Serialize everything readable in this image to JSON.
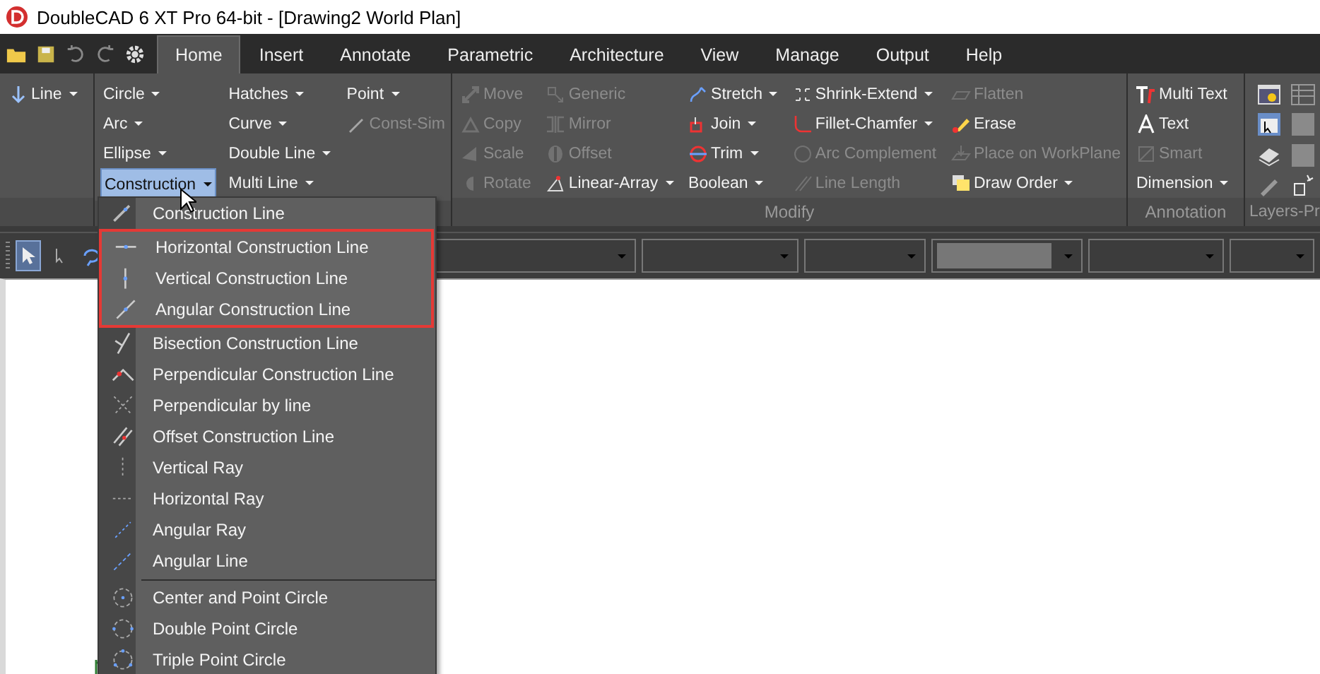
{
  "window": {
    "title": "DoubleCAD 6 XT Pro 64-bit - [Drawing2 World Plan]"
  },
  "tabs": [
    {
      "label": "Home",
      "selected": true
    },
    {
      "label": "Insert",
      "selected": false
    },
    {
      "label": "Annotate",
      "selected": false
    },
    {
      "label": "Parametric",
      "selected": false
    },
    {
      "label": "Architecture",
      "selected": false
    },
    {
      "label": "View",
      "selected": false
    },
    {
      "label": "Manage",
      "selected": false
    },
    {
      "label": "Output",
      "selected": false
    },
    {
      "label": "Help",
      "selected": false
    }
  ],
  "ribbon": {
    "groups": [
      {
        "columns": [
          [
            {
              "label": "Line",
              "dropdown": true,
              "disabled": false,
              "selected": false
            }
          ]
        ]
      },
      {
        "columns": [
          [
            {
              "label": "Circle",
              "dropdown": true,
              "disabled": false,
              "selected": false
            },
            {
              "label": "Arc",
              "dropdown": true,
              "disabled": false,
              "selected": false
            },
            {
              "label": "Ellipse",
              "dropdown": true,
              "disabled": false,
              "selected": false
            },
            {
              "label": "Construction",
              "dropdown": true,
              "disabled": false,
              "selected": true
            }
          ],
          [
            {
              "label": "Hatches",
              "dropdown": true,
              "disabled": false,
              "selected": false
            },
            {
              "label": "Curve",
              "dropdown": true,
              "disabled": false,
              "selected": false
            },
            {
              "label": "Double Line",
              "dropdown": true,
              "disabled": false,
              "selected": false
            },
            {
              "label": "Multi Line",
              "dropdown": true,
              "disabled": false,
              "selected": false
            }
          ],
          [
            {
              "label": "Point",
              "dropdown": true,
              "disabled": false,
              "selected": false
            },
            {
              "label": "Const-Sim",
              "dropdown": false,
              "disabled": true,
              "selected": false
            }
          ]
        ]
      },
      {
        "label": "Modify",
        "columns": [
          [
            {
              "label": "Move",
              "dropdown": false,
              "disabled": true,
              "selected": false
            },
            {
              "label": "Copy",
              "dropdown": false,
              "disabled": true,
              "selected": false
            },
            {
              "label": "Scale",
              "dropdown": false,
              "disabled": true,
              "selected": false
            },
            {
              "label": "Rotate",
              "dropdown": false,
              "disabled": true,
              "selected": false
            }
          ],
          [
            {
              "label": "Generic",
              "dropdown": false,
              "disabled": true,
              "selected": false
            },
            {
              "label": "Mirror",
              "dropdown": false,
              "disabled": true,
              "selected": false
            },
            {
              "label": "Offset",
              "dropdown": false,
              "disabled": true,
              "selected": false
            },
            {
              "label": "Linear-Array",
              "dropdown": true,
              "disabled": false,
              "selected": false
            }
          ],
          [
            {
              "label": "Stretch",
              "dropdown": true,
              "disabled": false,
              "selected": false
            },
            {
              "label": "Join",
              "dropdown": true,
              "disabled": false,
              "selected": false
            },
            {
              "label": "Trim",
              "dropdown": true,
              "disabled": false,
              "selected": false
            },
            {
              "label": "Boolean",
              "dropdown": true,
              "disabled": false,
              "selected": false
            }
          ],
          [
            {
              "label": "Shrink-Extend",
              "dropdown": true,
              "disabled": false,
              "selected": false
            },
            {
              "label": "Fillet-Chamfer",
              "dropdown": true,
              "disabled": false,
              "selected": false
            },
            {
              "label": "Arc Complement",
              "dropdown": false,
              "disabled": true,
              "selected": false
            },
            {
              "label": "Line Length",
              "dropdown": false,
              "disabled": true,
              "selected": false
            }
          ],
          [
            {
              "label": "Flatten",
              "dropdown": false,
              "disabled": true,
              "selected": false
            },
            {
              "label": "Erase",
              "dropdown": false,
              "disabled": false,
              "selected": false
            },
            {
              "label": "Place on WorkPlane",
              "dropdown": false,
              "disabled": true,
              "selected": false
            },
            {
              "label": "Draw Order",
              "dropdown": true,
              "disabled": false,
              "selected": false
            }
          ]
        ]
      },
      {
        "label": "Annotation",
        "columns": [
          [
            {
              "label": "Multi Text",
              "dropdown": false,
              "disabled": false,
              "selected": false
            },
            {
              "label": "Text",
              "dropdown": false,
              "disabled": false,
              "selected": false
            },
            {
              "label": "Smart",
              "dropdown": false,
              "disabled": true,
              "selected": false
            },
            {
              "label": "Dimension",
              "dropdown": true,
              "disabled": false,
              "selected": false
            }
          ]
        ]
      },
      {
        "label": "Layers-Pr",
        "kind": "icons"
      }
    ]
  },
  "menu": {
    "sections": [
      [
        {
          "label": "Construction Line",
          "highlighted": false
        },
        {
          "label": "Horizontal Construction Line",
          "highlighted": true
        },
        {
          "label": "Vertical Construction Line",
          "highlighted": true
        },
        {
          "label": "Angular Construction Line",
          "highlighted": true
        },
        {
          "label": "Bisection Construction Line",
          "highlighted": false
        },
        {
          "label": "Perpendicular Construction Line",
          "highlighted": false
        },
        {
          "label": "Perpendicular by line",
          "highlighted": false
        },
        {
          "label": "Offset Construction Line",
          "highlighted": false
        },
        {
          "label": "Vertical Ray",
          "highlighted": false
        },
        {
          "label": "Horizontal Ray",
          "highlighted": false
        },
        {
          "label": "Angular Ray",
          "highlighted": false
        },
        {
          "label": "Angular Line",
          "highlighted": false
        }
      ],
      [
        {
          "label": "Center and Point Circle",
          "highlighted": false
        },
        {
          "label": "Double Point Circle",
          "highlighted": false
        },
        {
          "label": "Triple Point Circle",
          "highlighted": false
        }
      ]
    ]
  }
}
